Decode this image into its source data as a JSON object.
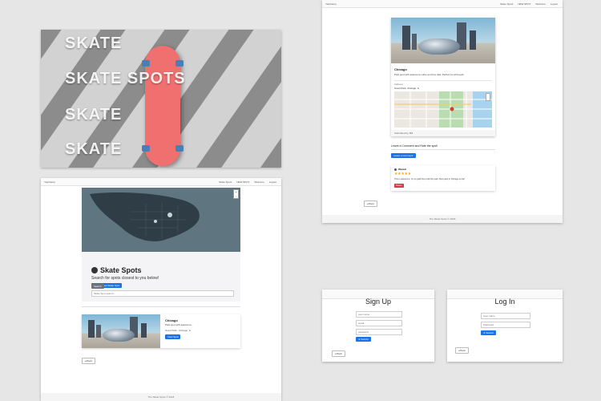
{
  "hero": {
    "words": [
      "SKATE",
      "SKATE SPOTS",
      "SKATE",
      "SKATE"
    ]
  },
  "nav": {
    "brand": "YelpCamp",
    "links": [
      "Skate Spots",
      "NEW SPOT",
      "Welcome",
      "Logout"
    ]
  },
  "index_page": {
    "title": "Skate Spots",
    "subtitle": "Search for spots closest to you below!",
    "add_button": "+ Add a new Skate Spot",
    "search_placeholder": "Skate Spot search...",
    "search_button": "Search",
    "card": {
      "title": "Chicago",
      "text": "Park spot with awesome...",
      "meta": "Grant Park - Chicago, IL",
      "button": "View Spot"
    },
    "back_button": "Back",
    "footer": "The Skate Spots © 2018"
  },
  "show_page": {
    "title": "Chicago",
    "description": "Park spot with awesome curbs and low rails. Perfect for all levels!",
    "address_label": "Address",
    "address": "Grant Park, Chicago, IL",
    "submitted": "Submitted by: Bill",
    "comment_heading": "Leave a Comment and Rate the spot!",
    "comment_button": "Leave a Comment",
    "comment": {
      "author": "Weiwei",
      "stars": "★★★★★",
      "text": "This is awesome. I'm so glad they built this park. Best park in Chicago so far!",
      "delete": "Delete"
    },
    "back_button": "Back",
    "footer": "The Skate Spots © 2018"
  },
  "signup_page": {
    "title": "Sign Up",
    "username_placeholder": "user name",
    "email_placeholder": "email",
    "password_placeholder": "password",
    "submit": "Submit",
    "back_button": "Back"
  },
  "login_page": {
    "title": "Log In",
    "username_placeholder": "User name",
    "password_placeholder": "Password",
    "submit": "Submit",
    "back_button": "Back"
  },
  "colors": {
    "primary": "#1a73e8",
    "danger": "#dc3545",
    "secondary": "#6c757d",
    "star": "#f5a623"
  }
}
